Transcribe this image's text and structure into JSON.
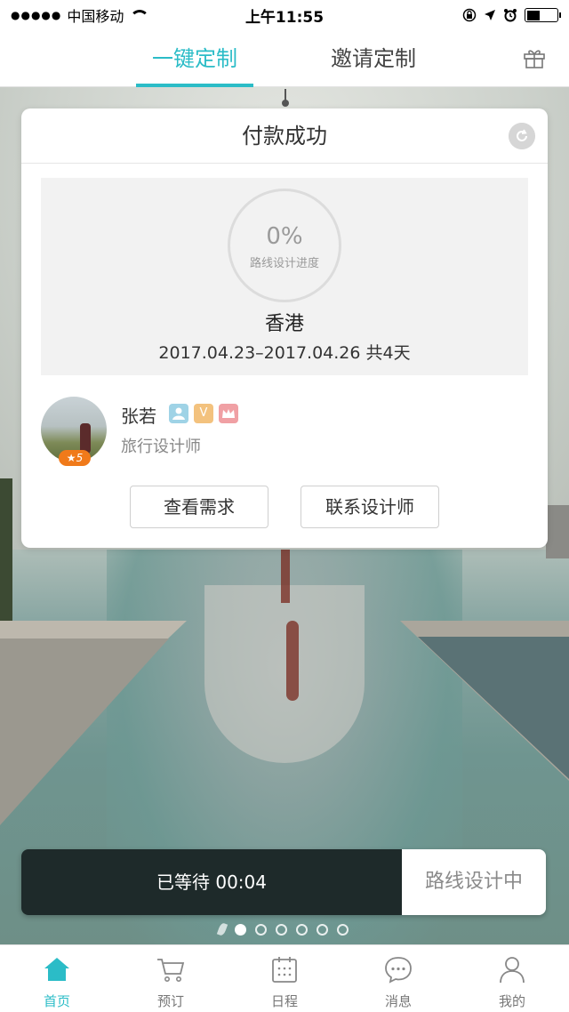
{
  "status_bar": {
    "carrier": "中国移动",
    "signal_dots": "●●●●●",
    "time": "上午11:55",
    "battery_level": 0.45
  },
  "top_tabs": {
    "tabs": [
      {
        "label": "一键定制",
        "active": true
      },
      {
        "label": "邀请定制",
        "active": false
      }
    ],
    "gift_icon": "gift-icon"
  },
  "card": {
    "title": "付款成功",
    "progress": {
      "percent": "0%",
      "label": "路线设计进度"
    },
    "destination": "香港",
    "dates": "2017.04.23–2017.04.26   共4天",
    "designer": {
      "name": "张若",
      "role": "旅行设计师",
      "rating": "5",
      "badges": [
        "user-badge",
        "V",
        "crown-badge"
      ]
    },
    "buttons": {
      "view_requirements": "查看需求",
      "contact_designer": "联系设计师"
    }
  },
  "wait_bar": {
    "waiting": "已等待 00:04",
    "status": "路线设计中"
  },
  "pager": {
    "count": 6,
    "active_index": 0
  },
  "bottom_nav": {
    "items": [
      {
        "label": "首页",
        "icon": "home-icon",
        "active": true
      },
      {
        "label": "预订",
        "icon": "cart-icon",
        "active": false
      },
      {
        "label": "日程",
        "icon": "calendar-icon",
        "active": false
      },
      {
        "label": "消息",
        "icon": "message-icon",
        "active": false
      },
      {
        "label": "我的",
        "icon": "profile-icon",
        "active": false
      }
    ]
  },
  "colors": {
    "accent": "#2bbcc7",
    "wait_bar_dark": "#1e2a2a",
    "rating_orange": "#f07a1a"
  }
}
